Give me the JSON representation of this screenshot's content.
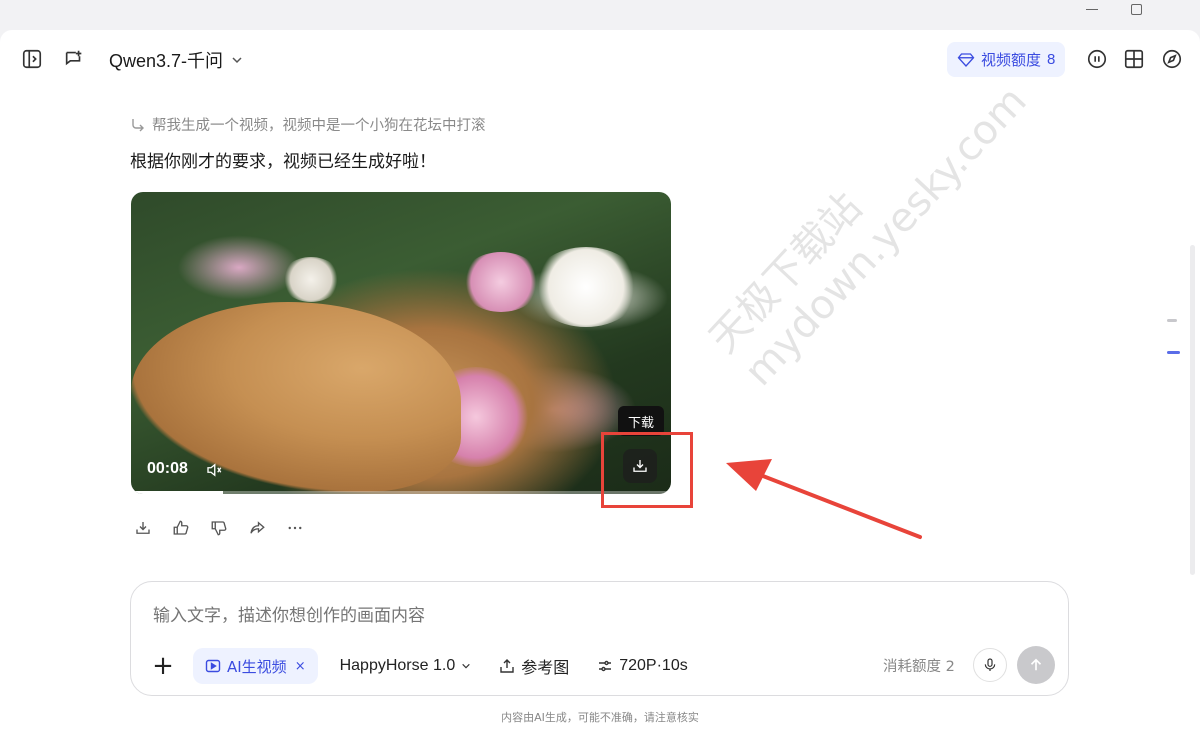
{
  "header": {
    "model_name": "Qwen3.7-千问",
    "quota_label": "视频额度",
    "quota_count": "8"
  },
  "conversation": {
    "user_prompt": "帮我生成一个视频，视频中是一个小狗在花坛中打滚",
    "assistant_reply": "根据你刚才的要求，视频已经生成好啦！",
    "video": {
      "elapsed": "00:08",
      "progress_fraction": 0.17,
      "download_tooltip": "下载"
    }
  },
  "watermark": {
    "line1": "天极下载站",
    "line2": "mydown.yesky.com"
  },
  "composer": {
    "placeholder": "输入文字，描述你想创作的画面内容",
    "mode_chip": "AI生视频",
    "mode_chip_close": "×",
    "model_select": "HappyHorse 1.0",
    "reference_label": "参考图",
    "resolution_label": "720P·10s",
    "cost_label": "消耗额度 2"
  },
  "footer": {
    "disclaimer": "内容由AI生成，可能不准确，请注意核实"
  },
  "colors": {
    "accent": "#3b4ce0",
    "accent_bg": "#eef2ff",
    "annotation_red": "#e8443a"
  }
}
